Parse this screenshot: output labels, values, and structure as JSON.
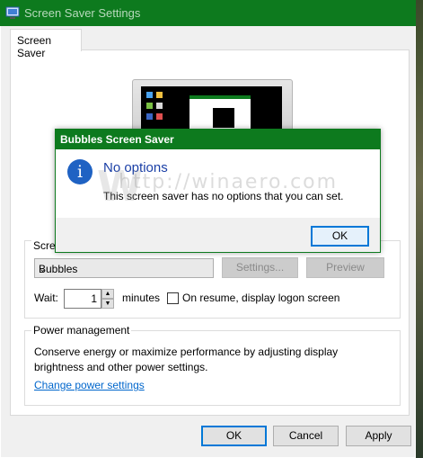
{
  "window": {
    "title": "Screen Saver Settings"
  },
  "tabs": [
    {
      "label": "Screen Saver"
    }
  ],
  "screen_saver": {
    "group_label": "Scree",
    "selected": "Bubbles",
    "settings_label": "Settings...",
    "preview_label": "Preview",
    "wait_label": "Wait:",
    "wait_value": "1",
    "minutes_label": "minutes",
    "resume_label": "On resume, display logon screen",
    "resume_checked": false
  },
  "power": {
    "group_label": "Power management",
    "description": "Conserve energy or maximize performance by adjusting display brightness and other power settings.",
    "link": "Change power settings"
  },
  "footer": {
    "ok": "OK",
    "cancel": "Cancel",
    "apply": "Apply"
  },
  "message_box": {
    "title": "Bubbles Screen Saver",
    "heading": "No options",
    "body": "This screen saver has no options that you can set.",
    "ok": "OK",
    "icon": "info-icon"
  },
  "watermark": {
    "text": "http://winaero.com",
    "logo_letter": "W"
  },
  "colors": {
    "title_bar": "#0d7a1e",
    "link": "#0066cc",
    "heading": "#1a3fa6",
    "info_icon": "#1f62c3"
  }
}
